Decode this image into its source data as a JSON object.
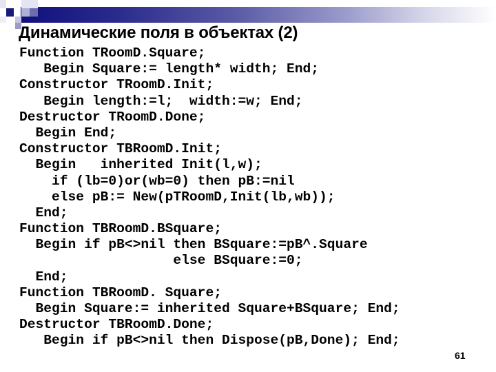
{
  "slide": {
    "title": "Динамические поля в объектах (2)",
    "page_number": "61",
    "colors": {
      "header_gradient_start": "#10107e",
      "header_gradient_end": "#ffffff",
      "text": "#000000",
      "background": "#ffffff"
    },
    "code_lines": [
      "Function TRoomD.Square;",
      "   Begin Square:= length* width; End;",
      "Constructor TRoomD.Init;",
      "   Begin length:=l;  width:=w; End;",
      "Destructor TRoomD.Done;",
      "  Begin End;",
      "Constructor TBRoomD.Init;",
      "  Begin   inherited Init(l,w);",
      "    if (lb=0)or(wb=0) then pB:=nil",
      "    else pB:= New(pTRoomD,Init(lb,wb));",
      "  End;",
      "Function TBRoomD.BSquare;",
      "  Begin if pB<>nil then BSquare:=pB^.Square",
      "                   else BSquare:=0;",
      "  End;",
      "Function TBRoomD. Square;",
      "  Begin Square:= inherited Square+BSquare; End;",
      "Destructor TBRoomD.Done;",
      "   Begin if pB<>nil then Dispose(pB,Done); End;"
    ]
  }
}
